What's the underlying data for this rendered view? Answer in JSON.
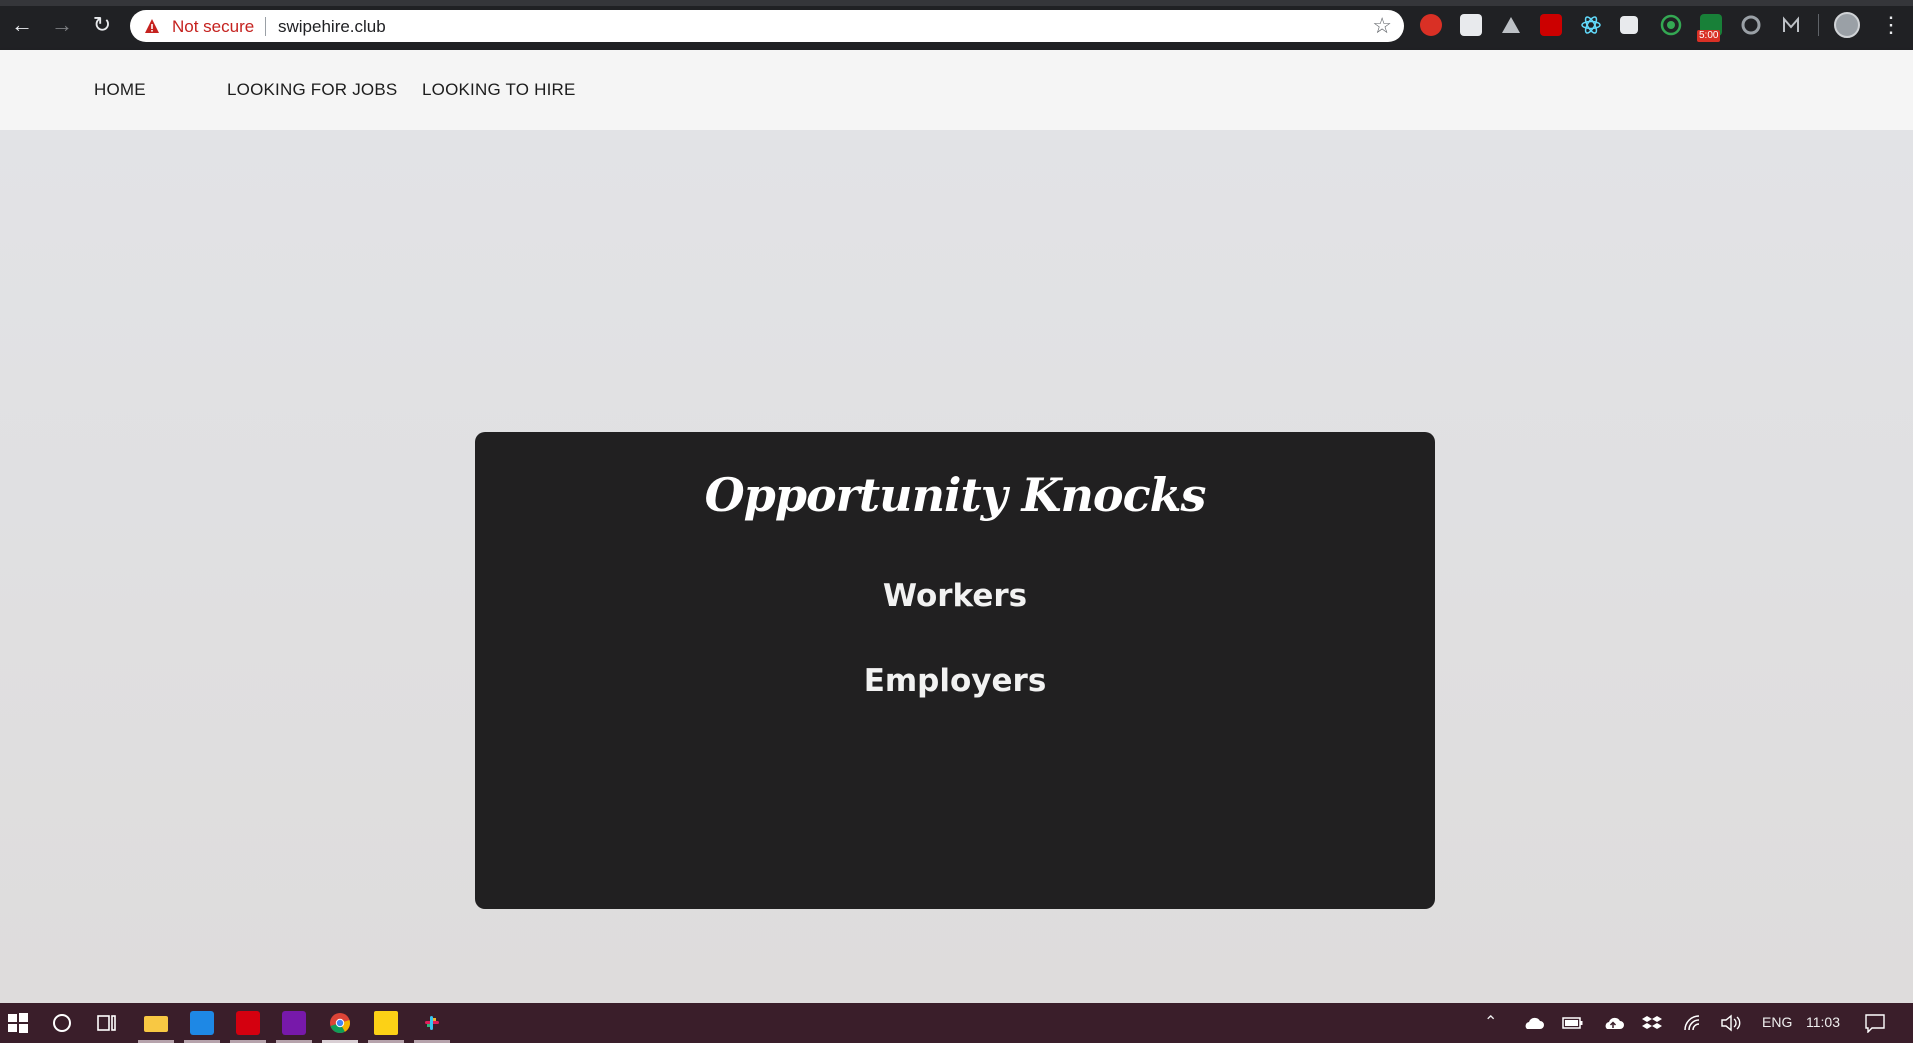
{
  "browser": {
    "security_label": "Not secure",
    "url": "swipehire.club",
    "extension_badge": "5:00",
    "icons": [
      "back-arrow-icon",
      "forward-arrow-icon",
      "reload-icon",
      "warning-icon",
      "star-icon",
      "menu-dots-icon"
    ]
  },
  "nav": {
    "home": "HOME",
    "jobs": "LOOKING FOR JOBS",
    "hire": "LOOKING TO HIRE"
  },
  "card": {
    "title": "Opportunity Knocks",
    "workers": "Workers",
    "employers": "Employers"
  },
  "taskbar": {
    "language": "ENG",
    "time": "11:03",
    "icons": [
      "windows-start-icon",
      "search-circle-icon",
      "task-view-icon",
      "file-explorer-icon",
      "vscode-icon",
      "acrobat-icon",
      "onenote-icon",
      "chrome-icon",
      "sticky-notes-icon",
      "slack-icon"
    ]
  },
  "colors": {
    "chrome_bar": "#202124",
    "nav_bg": "#f5f5f5",
    "card_bg": "#212021",
    "taskbar_bg": "#3a1e2a",
    "warning_red": "#c5221f"
  }
}
